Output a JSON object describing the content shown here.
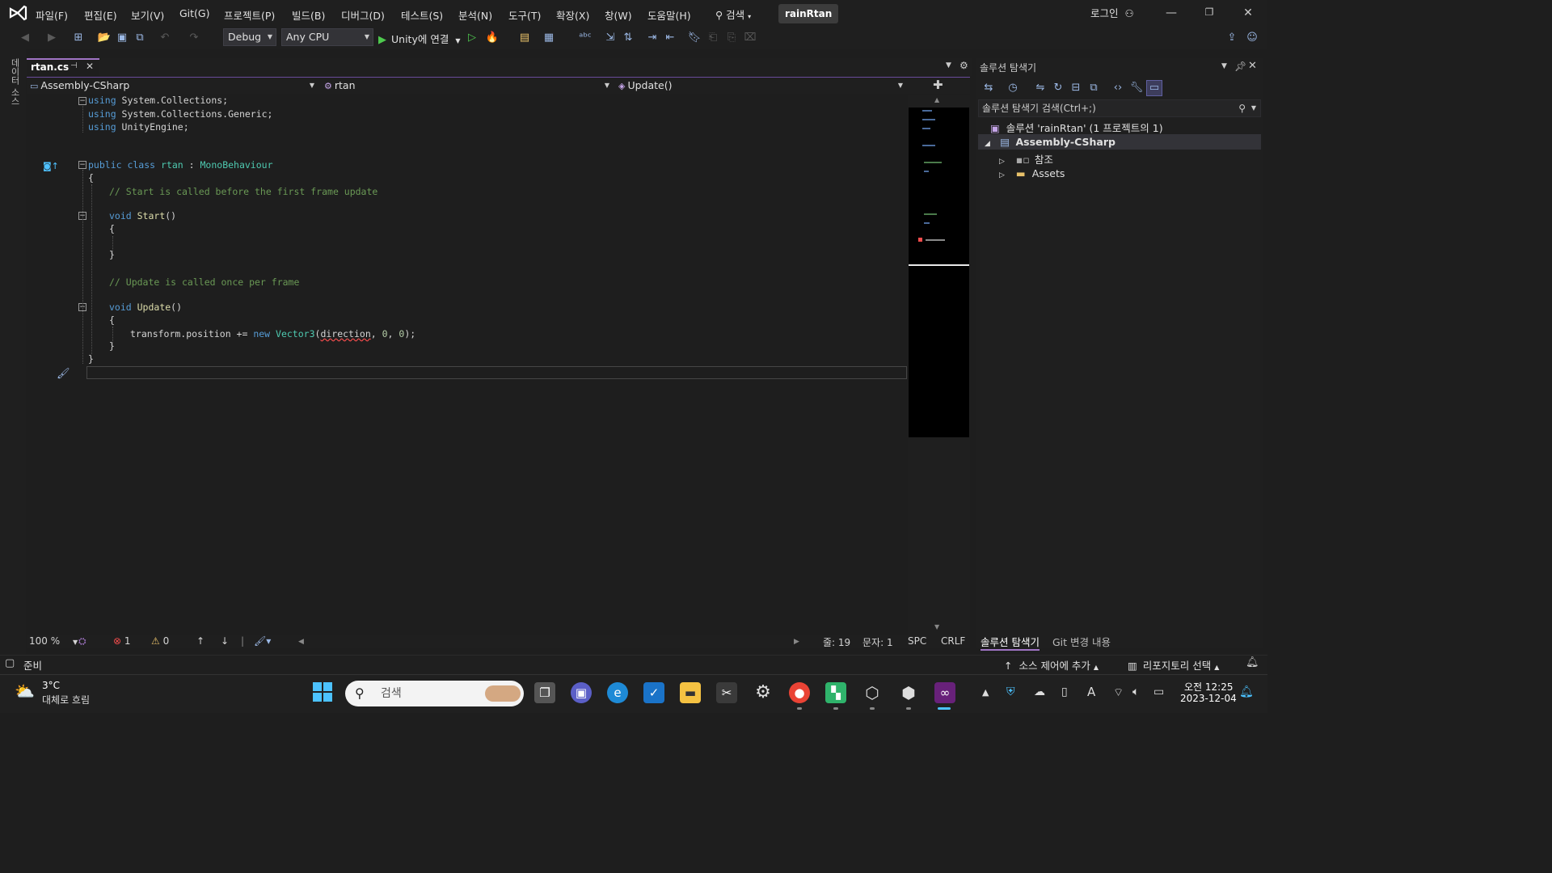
{
  "title_bar": {
    "menus": [
      "파일(F)",
      "편집(E)",
      "보기(V)",
      "Git(G)",
      "프로젝트(P)",
      "빌드(B)",
      "디버그(D)",
      "테스트(S)",
      "분석(N)",
      "도구(T)",
      "확장(X)",
      "창(W)",
      "도움말(H)"
    ],
    "search_label": "검색",
    "solution_name": "rainRtan",
    "login": "로그인"
  },
  "toolbar": {
    "configuration": "Debug",
    "platform": "Any CPU",
    "run_label": "Unity에 연결"
  },
  "left_strip": {
    "label": "데이터 소스"
  },
  "editor": {
    "tab_name": "rtan.cs",
    "nav": {
      "project": "Assembly-CSharp",
      "type": "rtan",
      "member": "Update()"
    },
    "code_lines": [
      [
        "using",
        " System.Collections;"
      ],
      [
        "using",
        " System.Collections.Generic;"
      ],
      [
        "using",
        " UnityEngine;"
      ]
    ],
    "code": {
      "l1_kw": "using",
      "l1_rest": " System.Collections;",
      "l2_kw": "using",
      "l2_rest": " System.Collections.Generic;",
      "l3_kw": "using",
      "l3_rest": " UnityEngine;",
      "class_kw": "public class",
      "class_name": " rtan",
      "class_colon": " : ",
      "class_base": "MonoBehaviour",
      "brace_open": "{",
      "comment_start": "// Start is called before the first frame update",
      "void_kw": "void",
      "start_name": " Start",
      "parens": "()",
      "brace_inner_open": "{",
      "brace_inner_close": "}",
      "comment_update": "// Update is called once per frame",
      "update_name": " Update",
      "stmt_a": "transform.position += ",
      "stmt_new": "new",
      "stmt_type": " Vector3",
      "stmt_paren": "(",
      "stmt_dir": "direction",
      "stmt_comma": ", ",
      "stmt_zero1": "0",
      "stmt_zero2": "0",
      "stmt_end": ");",
      "brace_close": "}"
    },
    "status": {
      "zoom": "100 %",
      "errors": "1",
      "warnings": "0",
      "line": "줄: 19",
      "char": "문자: 1",
      "spacing": "SPC",
      "line_ending": "CRLF"
    }
  },
  "solution_explorer": {
    "title": "솔루션 탐색기",
    "search_placeholder": "솔루션 탐색기 검색(Ctrl+;)",
    "solution_label": "솔루션 'rainRtan' (1 프로젝트의 1)",
    "project": "Assembly-CSharp",
    "items": [
      "참조",
      "Assets"
    ],
    "tabs": [
      "솔루션 탐색기",
      "Git 변경 내용"
    ]
  },
  "status_bar": {
    "ready": "준비",
    "source_control": "소스 제어에 추가",
    "repository": "리포지토리 선택"
  },
  "taskbar": {
    "weather_temp": "3°C",
    "weather_desc": "대체로 흐림",
    "search": "검색",
    "time_ampm": "오전 12:25",
    "date": "2023-12-04"
  }
}
